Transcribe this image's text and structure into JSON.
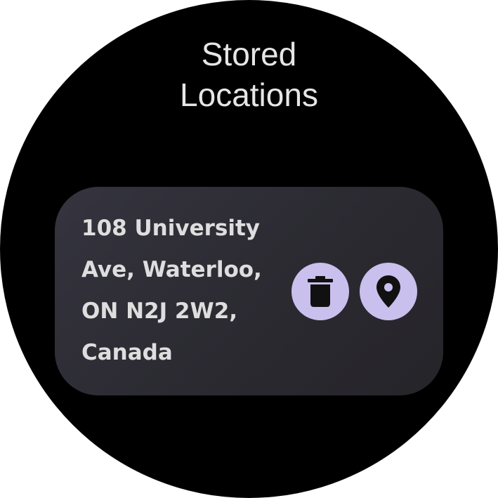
{
  "screen": {
    "title_lines": [
      "Stored",
      "Locations"
    ]
  },
  "location_card": {
    "address_lines": [
      "108 University",
      "Ave, Waterloo,",
      "ON N2J 2W2,",
      "Canada"
    ],
    "delete_icon": "trash-icon",
    "navigate_icon": "map-pin-icon"
  },
  "colors": {
    "background": "#000000",
    "card": "#2e2d34",
    "button": "#c9c0ee",
    "icon": "#111111",
    "text": "#dedede"
  }
}
